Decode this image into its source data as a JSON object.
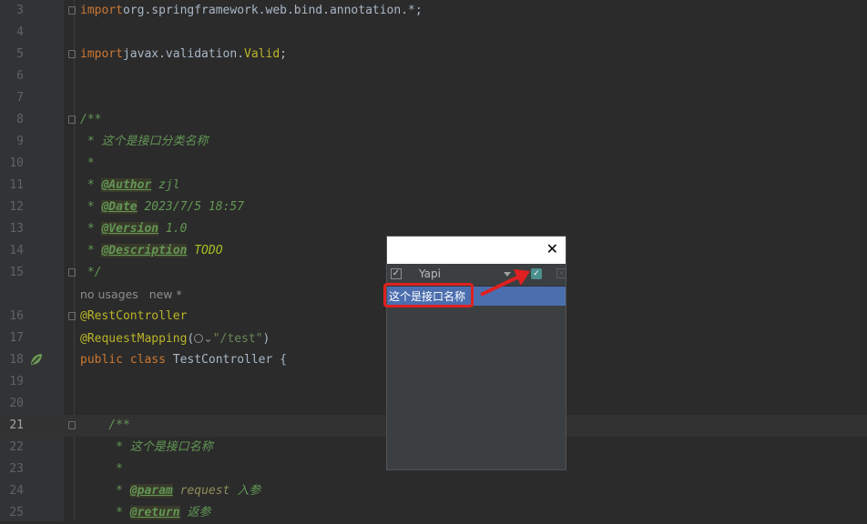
{
  "editor": {
    "lines": [
      {
        "num": "3",
        "parts": [
          [
            "kw",
            "import"
          ],
          [
            "",
            "org.springframework.web.bind.annotation.*;"
          ]
        ]
      },
      {
        "num": "4",
        "parts": []
      },
      {
        "num": "5",
        "parts": [
          [
            "kw",
            "import"
          ],
          [
            "",
            "javax.validation."
          ],
          [
            "ann",
            "Valid"
          ],
          [
            "",
            ";"
          ]
        ]
      },
      {
        "num": "6",
        "parts": []
      },
      {
        "num": "7",
        "parts": []
      },
      {
        "num": "8",
        "parts": [
          [
            "doc",
            "/**"
          ]
        ]
      },
      {
        "num": "9",
        "parts": [
          [
            "doc",
            " * 这个是接口分类名称"
          ]
        ]
      },
      {
        "num": "10",
        "parts": [
          [
            "doc",
            " *"
          ]
        ]
      },
      {
        "num": "11",
        "parts": [
          [
            "doc",
            " * "
          ],
          [
            "tag",
            "@Author"
          ],
          [
            "doc",
            " zjl"
          ]
        ]
      },
      {
        "num": "12",
        "parts": [
          [
            "doc",
            " * "
          ],
          [
            "tag",
            "@Date"
          ],
          [
            "doc",
            " 2023/7/5 18:57"
          ]
        ]
      },
      {
        "num": "13",
        "parts": [
          [
            "doc",
            " * "
          ],
          [
            "tag",
            "@Version"
          ],
          [
            "doc",
            " 1.0"
          ]
        ]
      },
      {
        "num": "14",
        "parts": [
          [
            "doc",
            " * "
          ],
          [
            "tag",
            "@Description"
          ],
          [
            "todo",
            " TODO"
          ]
        ]
      },
      {
        "num": "15",
        "parts": [
          [
            "doc",
            " */"
          ]
        ]
      },
      {
        "num": "",
        "parts": [
          [
            "hint",
            "no usages   new *"
          ]
        ]
      },
      {
        "num": "16",
        "parts": [
          [
            "ann",
            "@RestController"
          ]
        ]
      },
      {
        "num": "17",
        "parts": [
          [
            "ann",
            "@RequestMapping"
          ],
          [
            "",
            "("
          ],
          [
            "globe",
            ""
          ],
          [
            "hint",
            "⌄"
          ],
          [
            "str",
            "\"/test\""
          ],
          [
            "",
            ")"
          ]
        ]
      },
      {
        "num": "18",
        "parts": [
          [
            "kw",
            "public class "
          ],
          [
            "",
            "TestController {"
          ]
        ]
      },
      {
        "num": "19",
        "parts": []
      },
      {
        "num": "20",
        "parts": []
      },
      {
        "num": "21",
        "parts": [
          [
            "doc",
            "    /**"
          ]
        ]
      },
      {
        "num": "22",
        "parts": [
          [
            "doc",
            "     * 这个是接口名称"
          ]
        ]
      },
      {
        "num": "23",
        "parts": [
          [
            "doc",
            "     *"
          ]
        ]
      },
      {
        "num": "24",
        "parts": [
          [
            "doc",
            "     * "
          ],
          [
            "tag",
            "@param"
          ],
          [
            "ital",
            " request"
          ],
          [
            "doc",
            " 入参"
          ]
        ]
      },
      {
        "num": "25",
        "parts": [
          [
            "doc",
            "     * "
          ],
          [
            "tag",
            "@return"
          ],
          [
            "doc",
            " 返参"
          ]
        ]
      }
    ]
  },
  "popup": {
    "close_glyph": "✕",
    "check_glyph": "✓",
    "xbox_glyph": "✕",
    "project_name": "Yapi",
    "selected_item": "这个是接口名称"
  },
  "colors": {
    "annotation_red": "#e02020",
    "selection_blue": "#4b6eaf"
  }
}
